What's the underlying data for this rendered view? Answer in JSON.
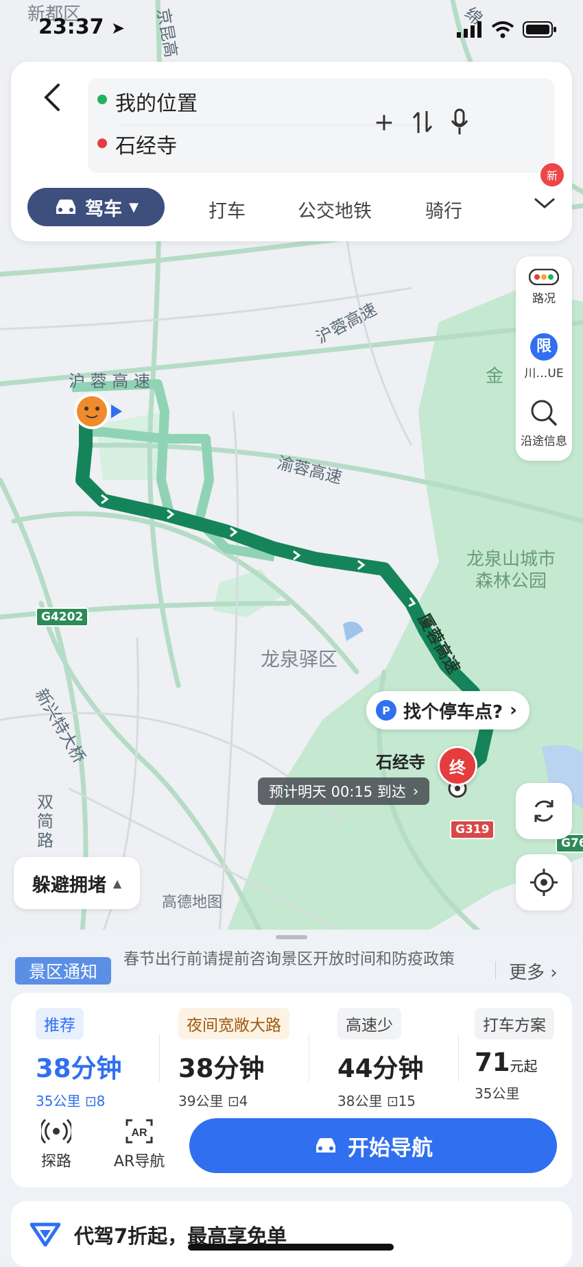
{
  "status_bar": {
    "time": "23:37"
  },
  "map": {
    "labels": {
      "district_top": "新都区",
      "district_mid": "龙泉驿区",
      "gold": "金",
      "park": "龙泉山城市森林公园",
      "park_line1": "龙泉山城市",
      "park_line2": "森林公园",
      "highway_hurong_1": "沪蓉高速",
      "highway_hurong_2": "沪 蓉 高 速",
      "highway_yurong": "渝蓉高速",
      "highway_xiarong": "厦蓉高速",
      "highway_jingkun": "京昆高",
      "highway_top_right": "绵",
      "road_xinxing": "新兴特大桥",
      "road_shuangjian": "双简路",
      "shield_g4202": "G4202",
      "shield_g319": "G319",
      "shield_g76": "G76"
    },
    "attribution": "高德地图"
  },
  "search": {
    "origin": "我的位置",
    "destination": "石经寺",
    "origin_color": "#21b35b",
    "destination_color": "#e53d3d"
  },
  "modes": {
    "active": "驾车",
    "tabs": [
      "打车",
      "公交地铁",
      "骑行"
    ],
    "new_badge": "新"
  },
  "side_tools": {
    "traffic": "路况",
    "restrict_icon": "限",
    "restrict_label": "川…UE",
    "along_route": "沿途信息"
  },
  "route_overlay": {
    "parking": "找个停车点?",
    "destination_name": "石经寺",
    "dest_marker": "终",
    "eta": "预计明天 00:15 到达"
  },
  "avoid_btn": "躲避拥堵",
  "notice": {
    "tag": "景区通知",
    "text": "春节出行前请提前咨询景区开放时间和防疫政策",
    "more": "更多"
  },
  "routes": [
    {
      "tag": "推荐",
      "time": "38分钟",
      "distance": "35公里",
      "lights": "8",
      "highlight": true
    },
    {
      "tag": "夜间宽敞大路",
      "time": "38分钟",
      "distance": "39公里",
      "lights": "4",
      "highlight": false
    },
    {
      "tag": "高速少",
      "time": "44分钟",
      "distance": "38公里",
      "lights": "15",
      "highlight": false
    },
    {
      "tag": "打车方案",
      "time": "71",
      "unit": "元起",
      "distance": "35公里",
      "highlight": false
    }
  ],
  "actions": {
    "explore": "探路",
    "ar": "AR导航",
    "start": "开始导航"
  },
  "promo": {
    "text": "代驾7折起，最高享免单"
  },
  "colors": {
    "accent": "#2f6ff0",
    "route_main": "#15845a",
    "route_alt": "#8fd3b4",
    "mode_pill": "#3d4f7c",
    "park_green": "#bfe6cc"
  }
}
